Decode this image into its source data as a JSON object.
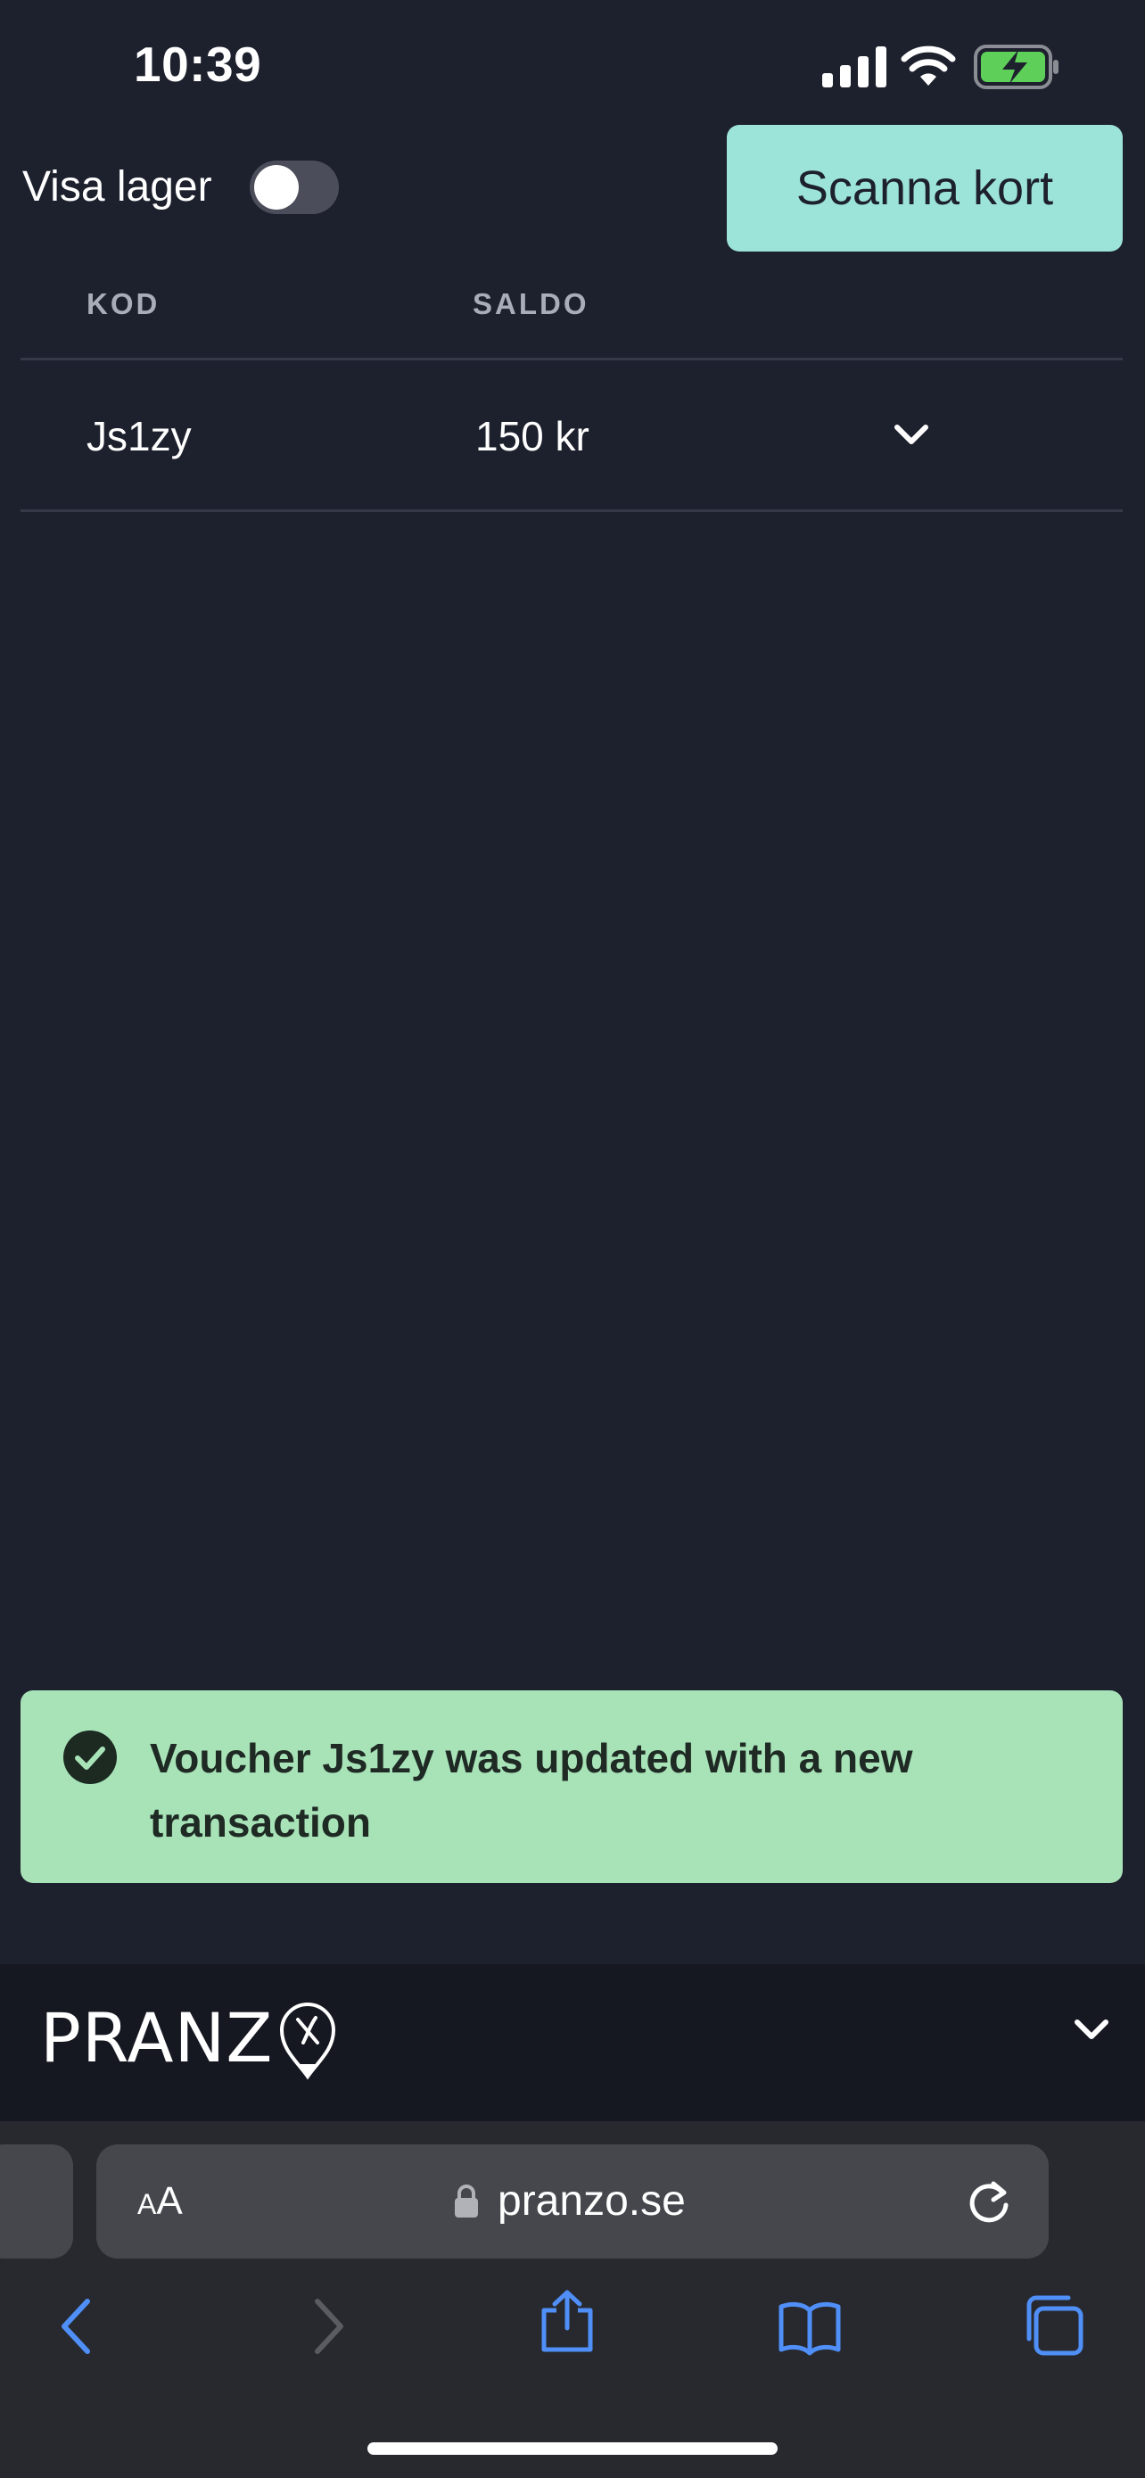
{
  "status_bar": {
    "time": "10:39"
  },
  "controls": {
    "toggle_label": "Visa lager",
    "toggle_on": false,
    "scan_button": "Scanna kort"
  },
  "table": {
    "columns": [
      "KOD",
      "SALDO"
    ],
    "rows": [
      {
        "code": "Js1zy",
        "balance": "150 kr"
      }
    ]
  },
  "toast": {
    "message": "Voucher Js1zy was updated with a new transaction",
    "icon": "check-circle-icon"
  },
  "footer": {
    "logo_text": "PRANZ",
    "icon": "chevron-down-icon"
  },
  "browser": {
    "text_size_small": "A",
    "text_size_large": "A",
    "url": "pranzo.se"
  },
  "colors": {
    "background": "#1d202d",
    "accent": "#9ce4d9",
    "toast": "#a8e3b8",
    "link_blue": "#4f8ff7"
  }
}
